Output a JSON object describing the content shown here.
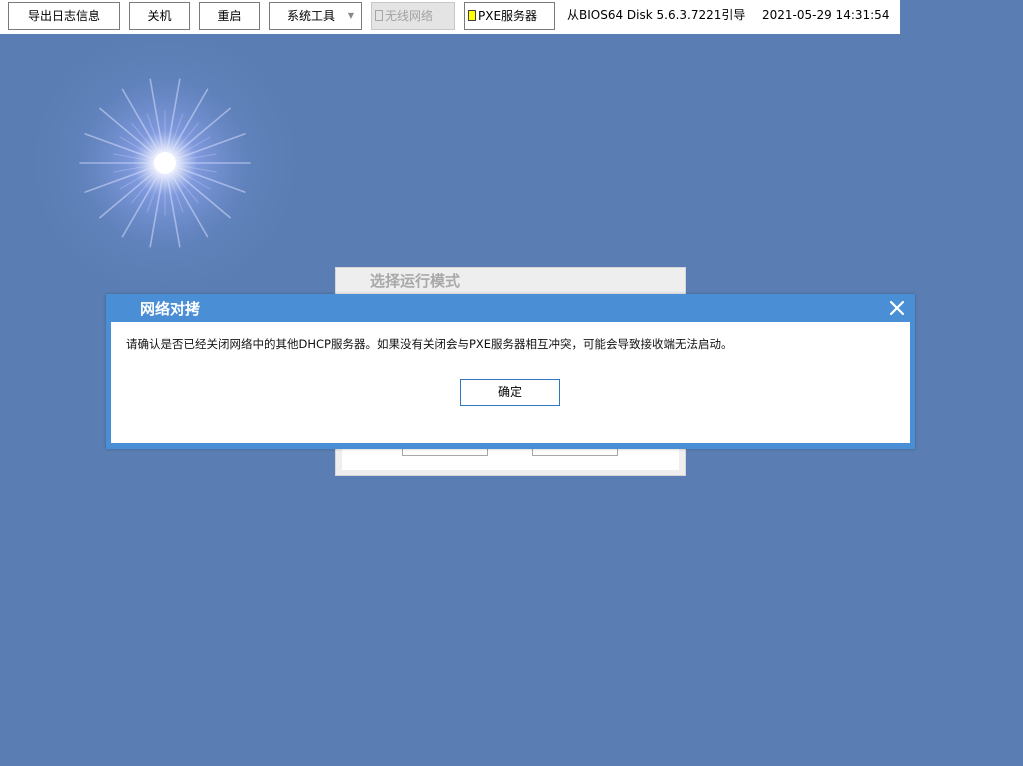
{
  "toolbar": {
    "export_log_label": "导出日志信息",
    "shutdown_label": "关机",
    "restart_label": "重启",
    "system_tools_label": "系统工具",
    "wireless_label": "无线网络",
    "pxe_server_label": "PXE服务器",
    "boot_info": "从BIOS64 Disk 5.6.3.7221引导",
    "datetime": "2021-05-29 14:31:54"
  },
  "mode_panel": {
    "title": "选择运行模式"
  },
  "dialog": {
    "title": "网络对拷",
    "message": "请确认是否已经关闭网络中的其他DHCP服务器。如果没有关闭会与PXE服务器相互冲突，可能会导致接收端无法启动。",
    "ok_label": "确定"
  },
  "icons": {
    "dropdown": "chevron-down-icon",
    "close": "close-icon",
    "wireless_checkbox": "checkbox-icon",
    "pxe_status": "status-indicator-icon"
  },
  "colors": {
    "desktop_background": "#5a7eb3",
    "dialog_accent": "#4a8ed6",
    "pxe_status": "#ffff00"
  }
}
